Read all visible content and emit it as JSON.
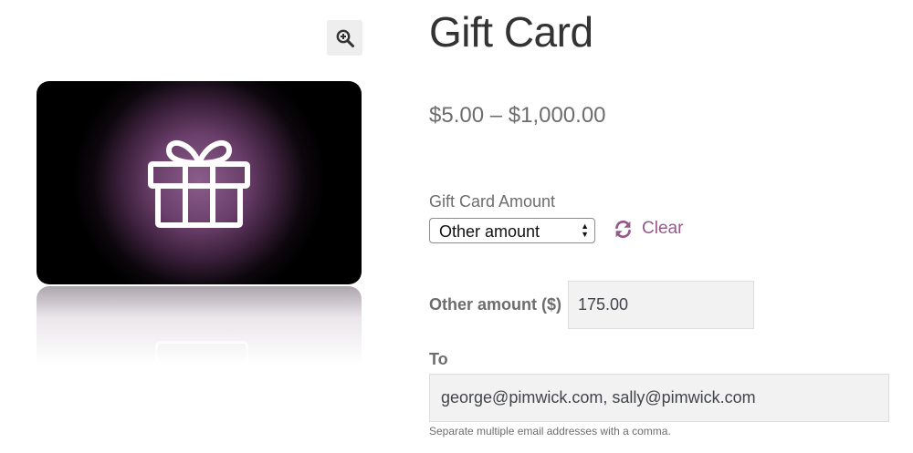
{
  "product": {
    "title": "Gift Card",
    "price": "$5.00 – $1,000.00"
  },
  "gallery": {
    "zoom_icon": "zoom-in-icon",
    "image_icon": "gift-icon"
  },
  "form": {
    "amount_label": "Gift Card Amount",
    "amount_selected": "Other amount",
    "clear_label": "Clear",
    "clear_icon": "refresh-icon",
    "other_amount_label": "Other amount ($)",
    "other_amount_value": "175.00",
    "to_label": "To",
    "to_value": "george@pimwick.com, sally@pimwick.com",
    "to_hint": "Separate multiple email addresses with a comma."
  },
  "colors": {
    "accent": "#96588a",
    "input_bg": "#f2f2f2",
    "card_bg": "#000000"
  }
}
